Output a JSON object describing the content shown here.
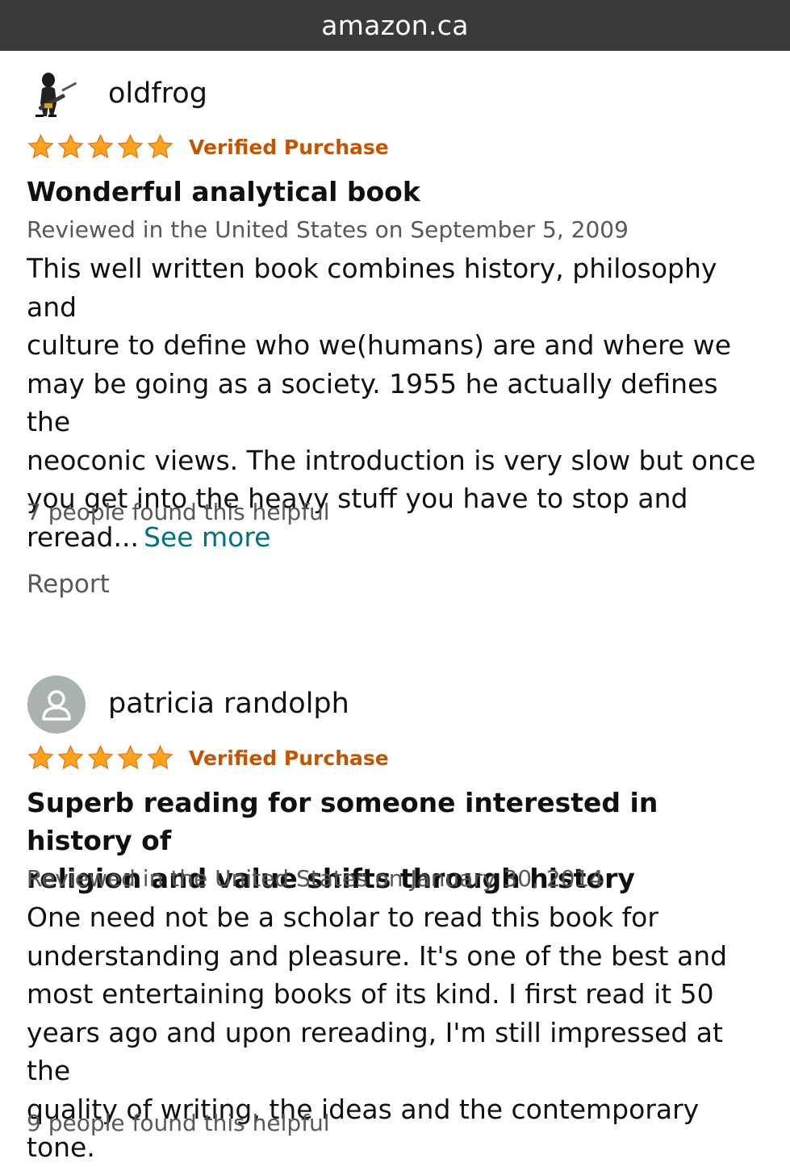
{
  "browser": {
    "url": "amazon.ca"
  },
  "colors": {
    "star": "#ffa41c",
    "verified": "#c45500",
    "link": "#007185",
    "meta": "#565959"
  },
  "reviews": [
    {
      "reviewer": "oldfrog",
      "avatar_icon": "figure-with-rifle-icon",
      "stars": 5,
      "verified_label": "Verified Purchase",
      "title": "Wonderful analytical book",
      "date": "Reviewed in the United States on September 5, 2009",
      "body_lines": [
        "This well written book combines history, philosophy and",
        "culture to define who we(humans) are and where we",
        "may be going as a society. 1955 he actually defines the",
        "neoconic views. The introduction is very slow but once",
        "you get into the heavy stuff you have to stop and",
        "reread..."
      ],
      "see_more": "See more",
      "helpful": "7 people found this helpful",
      "report": "Report"
    },
    {
      "reviewer": "patricia randolph",
      "avatar_icon": "default-user-icon",
      "stars": 5,
      "verified_label": "Verified Purchase",
      "title_lines": [
        "Superb reading for someone interested in history of",
        "religion and value shifts through history"
      ],
      "date": "Reviewed in the United States on January 30, 2014",
      "body_lines": [
        "One need not be a scholar to read this book for",
        "understanding and pleasure. It's one of the best and",
        "most entertaining books of its kind. I first read it 50",
        "years ago and upon rereading, I'm still impressed at the",
        "quality of writing, the ideas and the contemporary tone."
      ],
      "helpful": "9 people found this helpful"
    }
  ]
}
